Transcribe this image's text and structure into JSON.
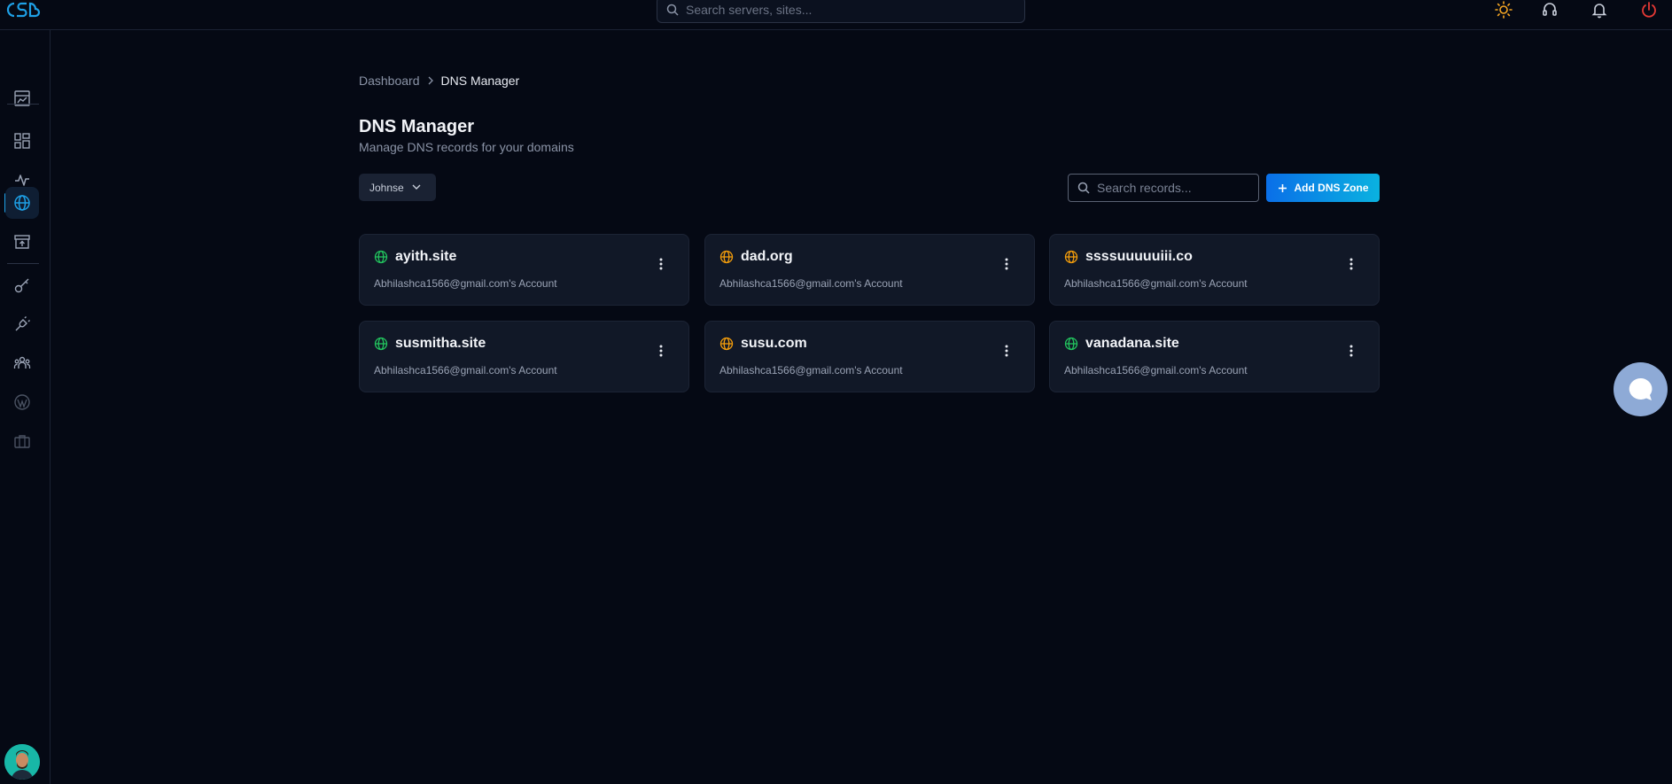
{
  "header": {
    "search_placeholder": "Search servers, sites..."
  },
  "breadcrumb": {
    "home": "Dashboard",
    "current": "DNS Manager"
  },
  "page": {
    "title": "DNS Manager",
    "subtitle": "Manage DNS records for your domains"
  },
  "toolbar": {
    "account_selected": "Johnse",
    "search_placeholder": "Search records...",
    "add_label": "Add DNS Zone"
  },
  "zones": [
    {
      "domain": "ayith.site",
      "account": "Abhilashca1566@gmail.com's Account",
      "status_color": "#22c55e"
    },
    {
      "domain": "dad.org",
      "account": "Abhilashca1566@gmail.com's Account",
      "status_color": "#f59e0b"
    },
    {
      "domain": "ssssuuuuuiii.co",
      "account": "Abhilashca1566@gmail.com's Account",
      "status_color": "#f59e0b"
    },
    {
      "domain": "susmitha.site",
      "account": "Abhilashca1566@gmail.com's Account",
      "status_color": "#22c55e"
    },
    {
      "domain": "susu.com",
      "account": "Abhilashca1566@gmail.com's Account",
      "status_color": "#f59e0b"
    },
    {
      "domain": "vanadana.site",
      "account": "Abhilashca1566@gmail.com's Account",
      "status_color": "#22c55e"
    }
  ],
  "colors": {
    "accent": "#1ea0e6",
    "background": "#050914",
    "card": "#111827"
  }
}
